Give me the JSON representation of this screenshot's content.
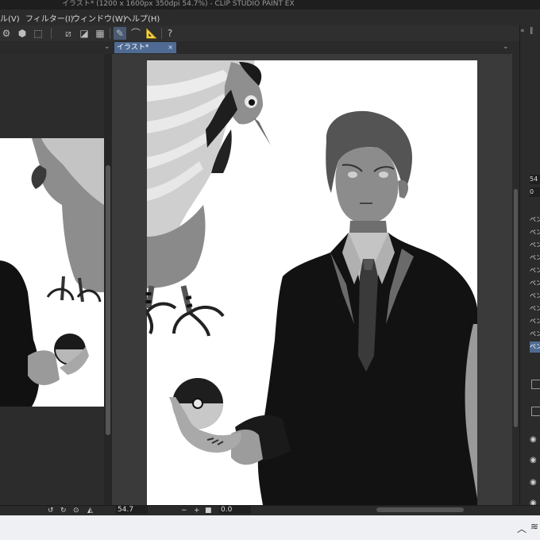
{
  "window": {
    "title": "イラスト* (1200 x 1600px 350dpi 54.7%)  - CLIP STUDIO PAINT EX"
  },
  "menu": [
    {
      "label": "ル(V)"
    },
    {
      "label": "フィルター(I)"
    },
    {
      "label": "ウィンドウ(W)"
    },
    {
      "label": "ヘルプ(H)"
    }
  ],
  "toolbar": {
    "icons": [
      "lasso-icon",
      "fill-icon",
      "transform-icon",
      "flip-h-icon",
      "flip-v-icon",
      "grid-icon",
      "pen-pressure-icon",
      "curve-icon",
      "ruler-icon",
      "help-icon"
    ]
  },
  "tab": {
    "label": "イラスト*",
    "close": "×"
  },
  "status": {
    "zoom_value": "54.7",
    "angle_value": "0.0"
  },
  "right_panel": {
    "field1": "54",
    "field2": "0",
    "brush_items": [
      "ペン",
      "ペン",
      "ペン",
      "ペン",
      "ペン",
      "ペン",
      "ペン",
      "ペン",
      "ペン",
      "ペン",
      "ペン"
    ],
    "selected_index": 10
  },
  "colors": {
    "tab_active": "#4f6b93",
    "panel_bg": "#2b2b2b",
    "canvas_bg": "#ffffff"
  }
}
